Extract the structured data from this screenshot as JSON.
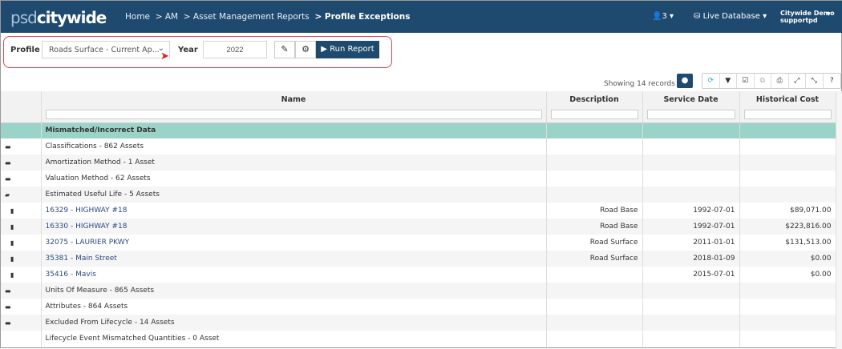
{
  "header": {
    "logo_a": "psd",
    "logo_b": "citywide",
    "breadcrumb": [
      "Home",
      ">  AM",
      ">  Asset Management Reports"
    ],
    "breadcrumb_current": ">  Profile Exceptions",
    "users_count": "3",
    "database": "Live Database",
    "user_org": "Citywide Demo",
    "user_name": "supportpd"
  },
  "toolbar": {
    "profile_label": "Profile",
    "profile_value": "Roads Surface - Current Ap...",
    "year_label": "Year",
    "year_value": "2022",
    "run_label": "Run Report"
  },
  "grid": {
    "showing": "Showing 14 records",
    "columns": [
      "Name",
      "Description",
      "Service Date",
      "Historical Cost"
    ],
    "group": "Mismatched/Incorrect Data",
    "rows": [
      {
        "icon": "folder",
        "name": "Classifications - 862 Assets",
        "desc": "",
        "date": "",
        "cost": ""
      },
      {
        "icon": "folder",
        "name": "Amortization Method - 1 Asset",
        "desc": "",
        "date": "",
        "cost": ""
      },
      {
        "icon": "folder",
        "name": "Valuation Method - 62 Assets",
        "desc": "",
        "date": "",
        "cost": ""
      },
      {
        "icon": "folder-open",
        "name": "Estimated Useful Life - 5 Assets",
        "desc": "",
        "date": "",
        "cost": ""
      },
      {
        "icon": "file",
        "name": "16329 - HIGHWAY #18",
        "desc": "Road Base",
        "date": "1992-07-01",
        "cost": "$89,071.00"
      },
      {
        "icon": "file",
        "name": "16330 - HIGHWAY #18",
        "desc": "Road Base",
        "date": "1992-07-01",
        "cost": "$223,816.00"
      },
      {
        "icon": "file",
        "name": "32075 - LAURIER PKWY",
        "desc": "Road Surface",
        "date": "2011-01-01",
        "cost": "$131,513.00"
      },
      {
        "icon": "file",
        "name": "35381 - Main Street",
        "desc": "Road Surface",
        "date": "2018-01-09",
        "cost": "$0.00"
      },
      {
        "icon": "file",
        "name": "35416 - Mavis",
        "desc": "",
        "date": "2015-07-01",
        "cost": "$0.00"
      },
      {
        "icon": "folder",
        "name": "Units Of Measure - 865 Assets",
        "desc": "",
        "date": "",
        "cost": ""
      },
      {
        "icon": "folder",
        "name": "Attributes - 864 Assets",
        "desc": "",
        "date": "",
        "cost": ""
      },
      {
        "icon": "folder",
        "name": "Excluded From Lifecycle - 14 Assets",
        "desc": "",
        "date": "",
        "cost": ""
      },
      {
        "icon": "",
        "name": "Lifecycle Event Mismatched Quantities - 0 Asset",
        "desc": "",
        "date": "",
        "cost": ""
      }
    ]
  }
}
